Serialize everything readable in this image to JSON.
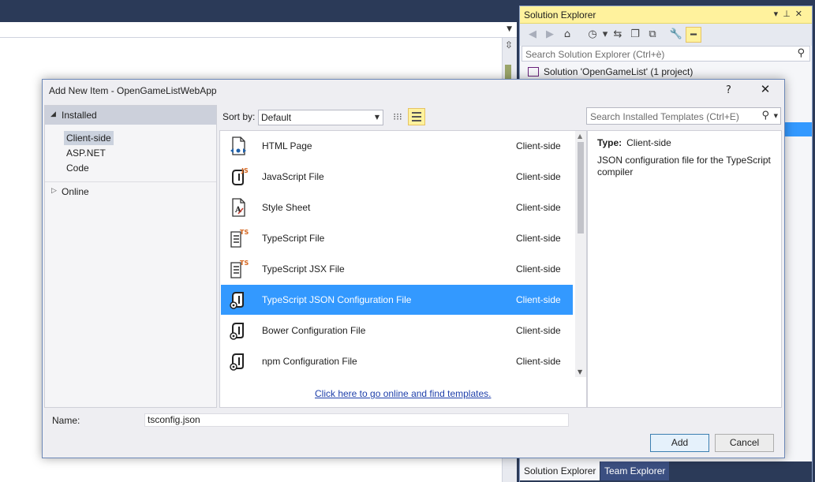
{
  "solution_explorer": {
    "title": "Solution Explorer",
    "search_placeholder": "Search Solution Explorer (Ctrl+è)",
    "root": "Solution 'OpenGameList' (1 project)",
    "tabs": [
      "Solution Explorer",
      "Team Explorer"
    ]
  },
  "dialog": {
    "title": "Add New Item - OpenGameListWebApp",
    "help": "?",
    "close": "✕",
    "tree": {
      "installed": "Installed",
      "items": [
        "Client-side",
        "ASP.NET",
        "Code"
      ],
      "selected": "Client-side",
      "online": "Online"
    },
    "sort_label": "Sort by:",
    "sort_value": "Default",
    "search_placeholder": "Search Installed Templates (Ctrl+E)",
    "templates": [
      {
        "name": "HTML Page",
        "category": "Client-side",
        "icon": "html-file-icon"
      },
      {
        "name": "JavaScript File",
        "category": "Client-side",
        "icon": "javascript-file-icon"
      },
      {
        "name": "Style Sheet",
        "category": "Client-side",
        "icon": "stylesheet-file-icon"
      },
      {
        "name": "TypeScript File",
        "category": "Client-side",
        "icon": "typescript-file-icon"
      },
      {
        "name": "TypeScript JSX File",
        "category": "Client-side",
        "icon": "typescript-jsx-file-icon"
      },
      {
        "name": "TypeScript JSON Configuration File",
        "category": "Client-side",
        "icon": "json-config-file-icon"
      },
      {
        "name": "Bower Configuration File",
        "category": "Client-side",
        "icon": "bower-config-file-icon"
      },
      {
        "name": "npm Configuration File",
        "category": "Client-side",
        "icon": "npm-config-file-icon"
      }
    ],
    "selected_template": "TypeScript JSON Configuration File",
    "online_link": "Click here to go online and find templates.",
    "details": {
      "type_label": "Type:",
      "type_value": "Client-side",
      "description": "JSON configuration file for the TypeScript compiler"
    },
    "name_label": "Name:",
    "name_value": "tsconfig.json",
    "add_button": "Add",
    "cancel_button": "Cancel"
  },
  "colors": {
    "accent": "#3399ff",
    "title_highlight": "#fff29d",
    "vs_dark": "#2b3a58"
  }
}
